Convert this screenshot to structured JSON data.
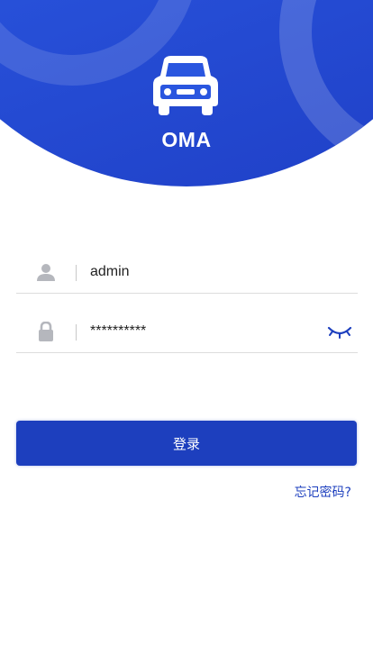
{
  "header": {
    "brand": "OMA",
    "logo_icon": "car-icon",
    "colors": {
      "banner_start": "#3a6ff0",
      "banner_end": "#1f3fc6"
    }
  },
  "form": {
    "username": {
      "icon": "user-icon",
      "value": "admin"
    },
    "password": {
      "icon": "lock-icon",
      "value": "**********",
      "toggle_icon": "eye-closed-icon"
    }
  },
  "actions": {
    "login_label": "登录",
    "forgot_label": "忘记密码?"
  },
  "colors": {
    "primary": "#1d3fbe"
  }
}
